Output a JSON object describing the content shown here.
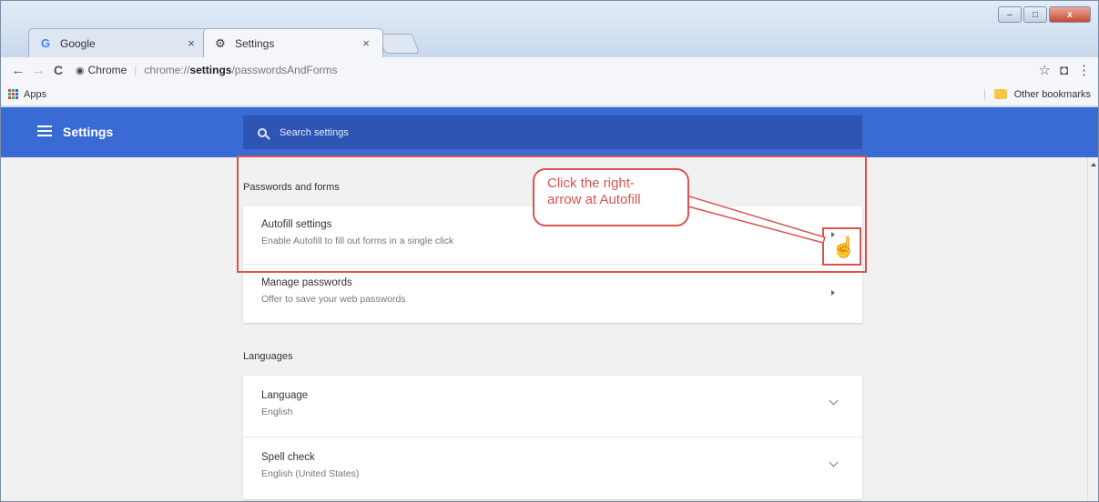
{
  "browser": {
    "tabs": [
      {
        "label": "Google",
        "icon": "google-icon",
        "close": "×"
      },
      {
        "label": "Settings",
        "icon": "gear-icon",
        "close": "×"
      }
    ],
    "window_controls": [
      "–",
      "□",
      "x"
    ],
    "nav": {
      "back": "←",
      "forward": "→",
      "reload": "C"
    },
    "omnibox": {
      "site_label": "Chrome",
      "separator": "|",
      "url_scheme": "chrome://",
      "url_host": "settings",
      "url_path": "/passwordsAndForms"
    },
    "toolbar_icons": {
      "star": "☆",
      "extension": "◘",
      "menu": "⋮"
    },
    "bookmarks": {
      "apps_label": "Apps",
      "other_label": "Other bookmarks"
    }
  },
  "settings": {
    "title": "Settings",
    "search_placeholder": "Search settings",
    "sections": [
      {
        "title": "Passwords and forms",
        "rows": [
          {
            "title": "Autofill settings",
            "subtitle": "Enable Autofill to fill out forms in a single click",
            "control": "right-arrow"
          },
          {
            "title": "Manage passwords",
            "subtitle": "Offer to save your web passwords",
            "control": "right-arrow"
          }
        ]
      },
      {
        "title": "Languages",
        "rows": [
          {
            "title": "Language",
            "subtitle": "English",
            "control": "chevron-down"
          },
          {
            "title": "Spell check",
            "subtitle": "English (United States)",
            "control": "chevron-down"
          }
        ]
      }
    ]
  },
  "annotation": {
    "callout_text": "Click the right-arrow at Autofill",
    "callout_line1": "Click the right-",
    "callout_line2": "arrow at Autofill",
    "color": "#d9534f"
  },
  "colors": {
    "header_blue": "#3a6ad4",
    "search_blue": "#2e55b3",
    "content_bg": "#f1f1f1"
  }
}
